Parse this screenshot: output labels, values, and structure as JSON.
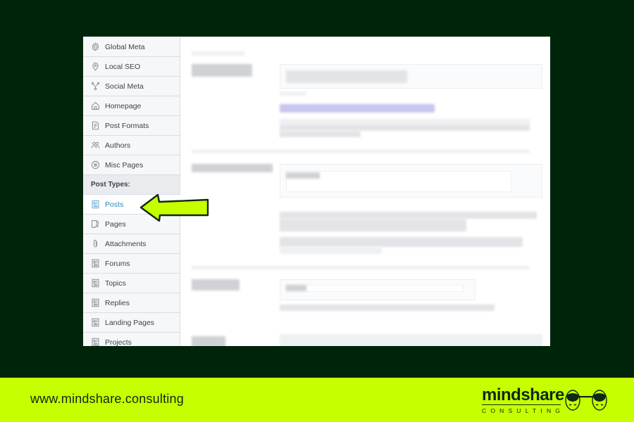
{
  "sidebar": {
    "items": [
      {
        "label": "Global Meta",
        "icon": "gear-icon"
      },
      {
        "label": "Local SEO",
        "icon": "location-pin-icon"
      },
      {
        "label": "Social Meta",
        "icon": "share-nodes-icon"
      },
      {
        "label": "Homepage",
        "icon": "home-icon"
      },
      {
        "label": "Post Formats",
        "icon": "document-icon"
      },
      {
        "label": "Authors",
        "icon": "users-icon"
      },
      {
        "label": "Misc Pages",
        "icon": "list-circle-icon"
      }
    ],
    "section_label": "Post Types:",
    "post_types": [
      {
        "label": "Posts",
        "icon": "post-icon",
        "active": true
      },
      {
        "label": "Pages",
        "icon": "pages-icon"
      },
      {
        "label": "Attachments",
        "icon": "paperclip-icon"
      },
      {
        "label": "Forums",
        "icon": "post-icon"
      },
      {
        "label": "Topics",
        "icon": "post-icon"
      },
      {
        "label": "Replies",
        "icon": "post-icon"
      },
      {
        "label": "Landing Pages",
        "icon": "post-icon"
      },
      {
        "label": "Projects",
        "icon": "post-icon"
      }
    ]
  },
  "annotation": {
    "type": "arrow",
    "points_to": "Posts",
    "color": "#c6ff00"
  },
  "footer": {
    "url": "www.mindshare.consulting",
    "logo_word": "mindshare",
    "logo_sub": "CONSULTING"
  },
  "colors": {
    "background": "#00240a",
    "accent": "#c6ff00",
    "active_link": "#2a8ab8"
  }
}
